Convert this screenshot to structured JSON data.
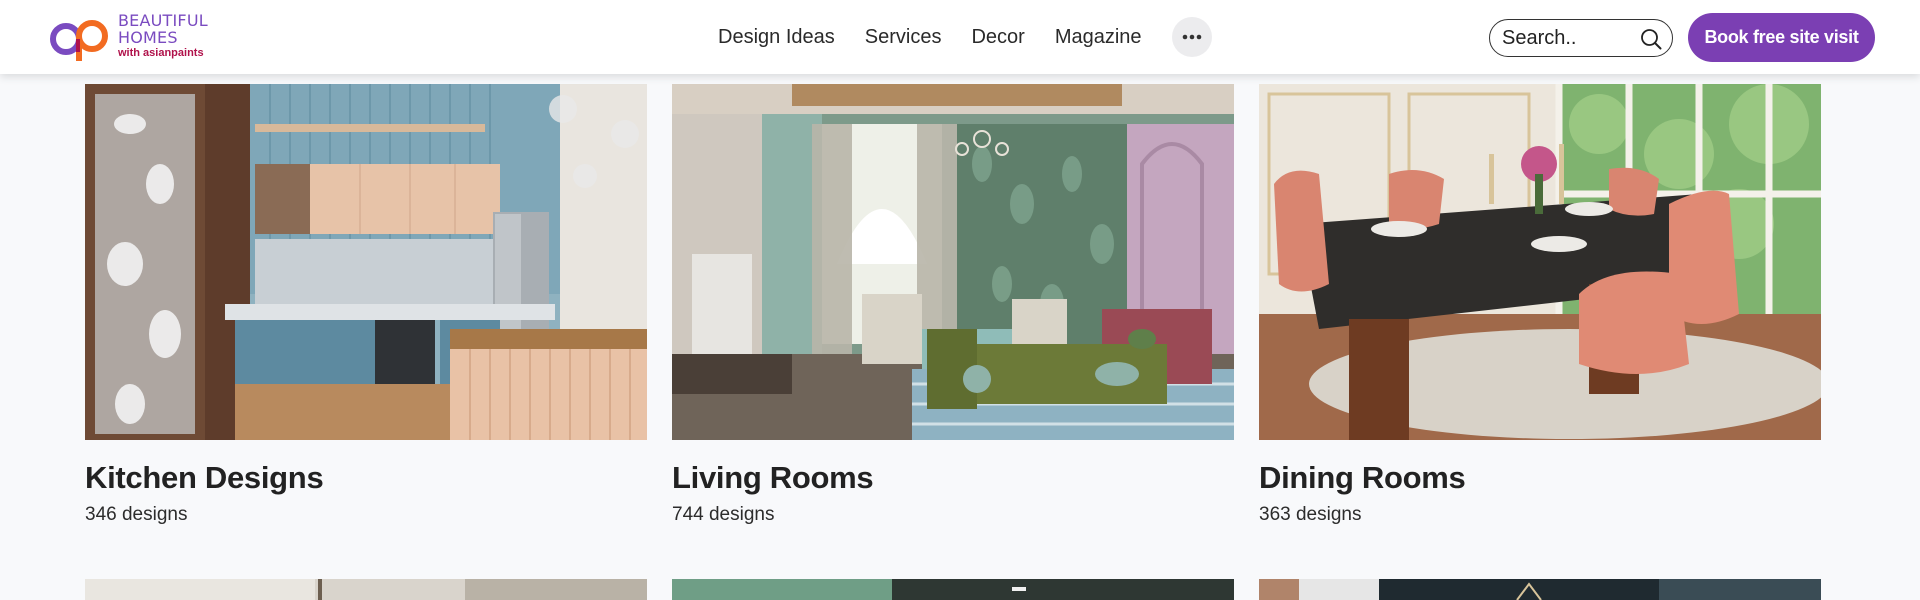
{
  "brand": {
    "line1": "BEAUTIFUL",
    "line2": "HOMES",
    "line3": "with asianpaints",
    "icon": "ap-logo-icon",
    "colors": {
      "primary": "#7b3fb3",
      "accent_orange": "#f26b21",
      "accent_red": "#b0124b"
    }
  },
  "nav": {
    "items": [
      {
        "label": "Design Ideas"
      },
      {
        "label": "Services"
      },
      {
        "label": "Decor"
      },
      {
        "label": "Magazine"
      }
    ],
    "more_icon": "more-horizontal-icon"
  },
  "search": {
    "placeholder": "Search..",
    "value": "",
    "icon": "search-icon"
  },
  "cta": {
    "label": "Book free site visit",
    "color": "#7b3fb3"
  },
  "cards": [
    {
      "title": "Kitchen Designs",
      "count": "346 designs",
      "image": "kitchen-photo"
    },
    {
      "title": "Living Rooms",
      "count": "744 designs",
      "image": "living-room-photo"
    },
    {
      "title": "Dining Rooms",
      "count": "363 designs",
      "image": "dining-room-photo"
    }
  ]
}
